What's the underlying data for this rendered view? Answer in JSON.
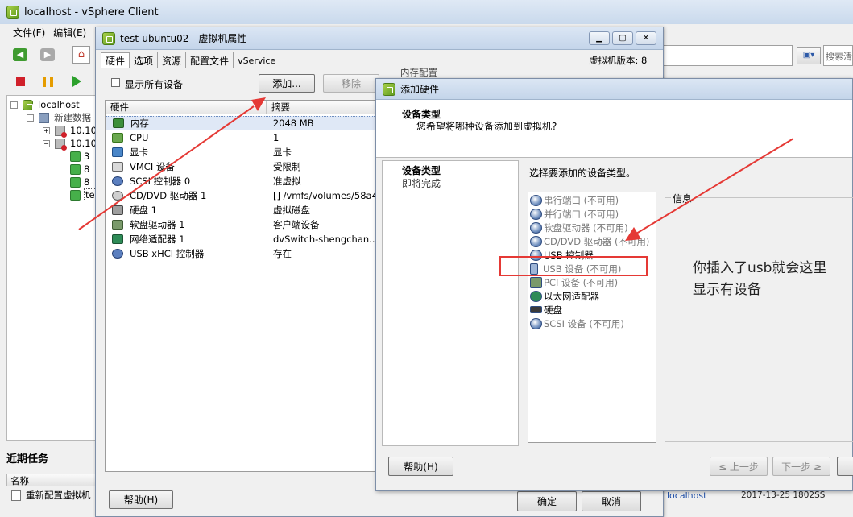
{
  "main": {
    "title": "localhost - vSphere Client",
    "menu": [
      "文件(F)",
      "编辑(E)"
    ],
    "search_placeholder": "搜索清",
    "tree": [
      {
        "label": "localhost",
        "indent": 0
      },
      {
        "label": "新建数据",
        "indent": 1
      },
      {
        "label": "10.10",
        "indent": 2
      },
      {
        "label": "10.10",
        "indent": 2
      },
      {
        "label": "3",
        "indent": 3
      },
      {
        "label": "8",
        "indent": 3
      },
      {
        "label": "8",
        "indent": 3
      },
      {
        "label": "te",
        "indent": 3
      }
    ],
    "recent_tasks_label": "近期任务",
    "recent_header": "名称",
    "recent_row": "重新配置虚拟机",
    "status_host": "localhost",
    "status_time": "2017-13-25 1802SS"
  },
  "vmprops": {
    "title": "test-ubuntu02 - 虚拟机属性",
    "tabs": [
      "硬件",
      "选项",
      "资源",
      "配置文件",
      "vService"
    ],
    "version_label": "虚拟机版本: 8",
    "show_all_label": "显示所有设备",
    "add_button": "添加...",
    "remove_button": "移除",
    "memory_config_label": "内存配置",
    "col_hardware": "硬件",
    "col_summary": "摘要",
    "rows": [
      {
        "name": "内存",
        "summary": "2048 MB"
      },
      {
        "name": "CPU",
        "summary": "1"
      },
      {
        "name": "显卡",
        "summary": "显卡"
      },
      {
        "name": "VMCI 设备",
        "summary": "受限制"
      },
      {
        "name": "SCSI 控制器  0",
        "summary": "准虚拟"
      },
      {
        "name": "CD/DVD 驱动器  1",
        "summary": "[] /vmfs/volumes/58a4..."
      },
      {
        "name": "硬盘  1",
        "summary": "虚拟磁盘"
      },
      {
        "name": "软盘驱动器  1",
        "summary": "客户端设备"
      },
      {
        "name": "网络适配器  1",
        "summary": "dvSwitch-shengchan..."
      },
      {
        "name": "USB xHCI 控制器",
        "summary": "存在"
      }
    ],
    "help_button": "帮助(H)",
    "ok_button": "确定",
    "cancel_button": "取消"
  },
  "addhw": {
    "title": "添加硬件",
    "heading": "设备类型",
    "subheading": "您希望将哪种设备添加到虚拟机?",
    "steps": [
      "设备类型",
      "即将完成"
    ],
    "prompt": "选择要添加的设备类型。",
    "devices": [
      {
        "label": "串行端口 (不可用)",
        "enabled": false
      },
      {
        "label": "并行端口 (不可用)",
        "enabled": false
      },
      {
        "label": "软盘驱动器 (不可用)",
        "enabled": false
      },
      {
        "label": "CD/DVD 驱动器 (不可用)",
        "enabled": false
      },
      {
        "label": "USB 控制器",
        "enabled": true
      },
      {
        "label": "USB 设备 (不可用)",
        "enabled": false
      },
      {
        "label": "PCI 设备 (不可用)",
        "enabled": false
      },
      {
        "label": "以太网适配器",
        "enabled": true
      },
      {
        "label": "硬盘",
        "enabled": true
      },
      {
        "label": "SCSI 设备 (不可用)",
        "enabled": false
      }
    ],
    "info_label": "信息",
    "help_button": "帮助(H)",
    "back_button": "≤ 上一步",
    "next_button": "下一步 ≥"
  },
  "annotation": {
    "line1": "你插入了usb就会这里",
    "line2": "显示有设备",
    "color": "#e53935"
  }
}
